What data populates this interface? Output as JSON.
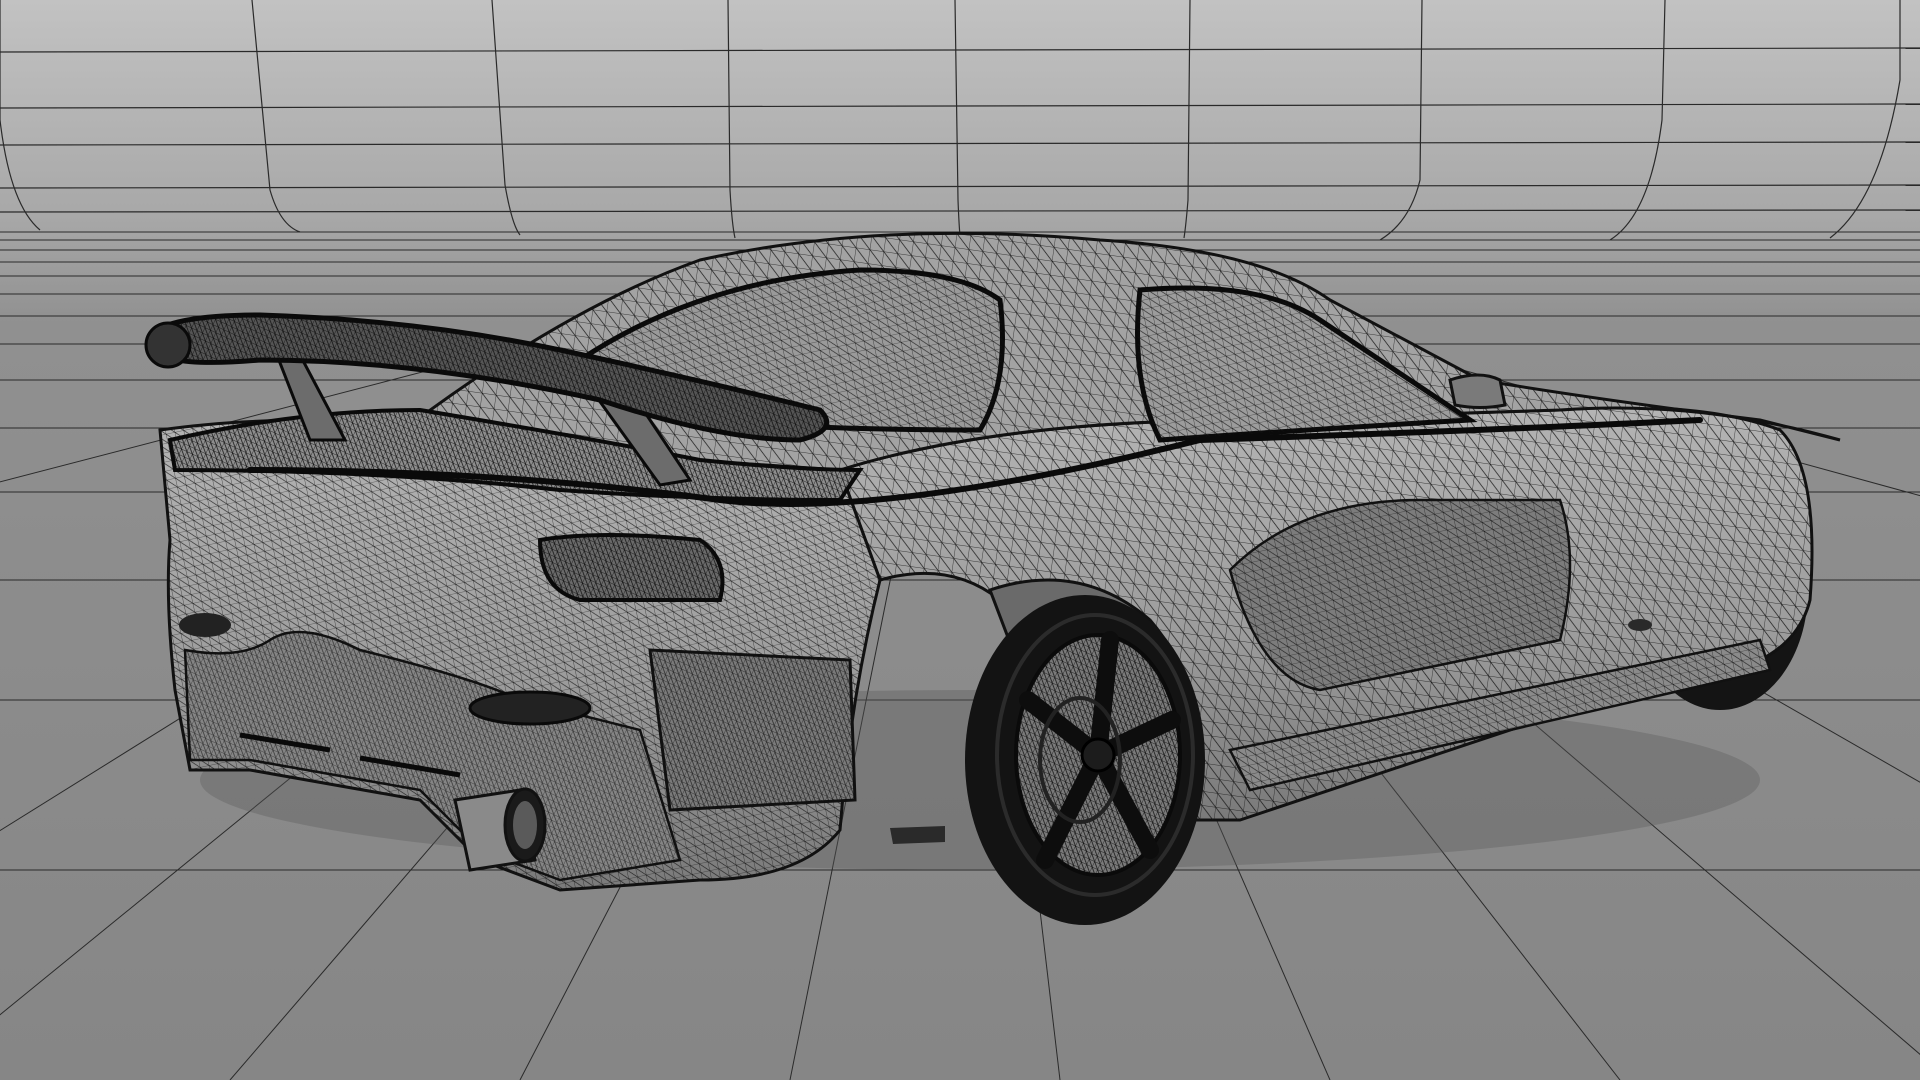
{
  "scene": {
    "subject": "wireframe-sports-car",
    "view": "rear-three-quarter",
    "render_style": "mesh-wireframe"
  },
  "colors": {
    "studio_wall_top": "#bdbdbd",
    "studio_floor": "#8a8a8a",
    "grid_line": "#2a2a2a",
    "car_body": "#9a9a9a",
    "car_shade": "#6e6e6e",
    "mesh_line": "#151515",
    "tire": "#141414"
  }
}
